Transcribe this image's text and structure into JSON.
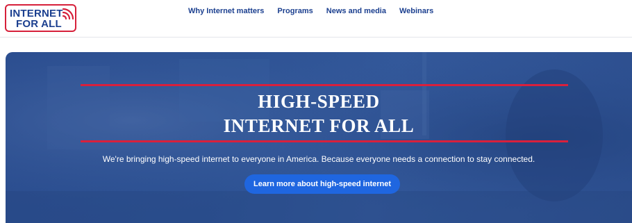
{
  "logo": {
    "line1": "INTERNET",
    "line2": "FOR ALL"
  },
  "nav": {
    "items": [
      {
        "label": "Why Internet matters"
      },
      {
        "label": "Programs"
      },
      {
        "label": "News and media"
      },
      {
        "label": "Webinars"
      }
    ]
  },
  "hero": {
    "title_line1": "HIGH-SPEED",
    "title_line2": "INTERNET FOR ALL",
    "subtitle": "We're bringing high-speed internet to everyone in America. Because everyone needs a connection to stay connected.",
    "cta_label": "Learn more about high-speed internet"
  },
  "colors": {
    "brand_blue": "#1b3f8f",
    "brand_red": "#d6203a",
    "hero_blue": "#2c5193",
    "cta_blue": "#1f66e0"
  }
}
